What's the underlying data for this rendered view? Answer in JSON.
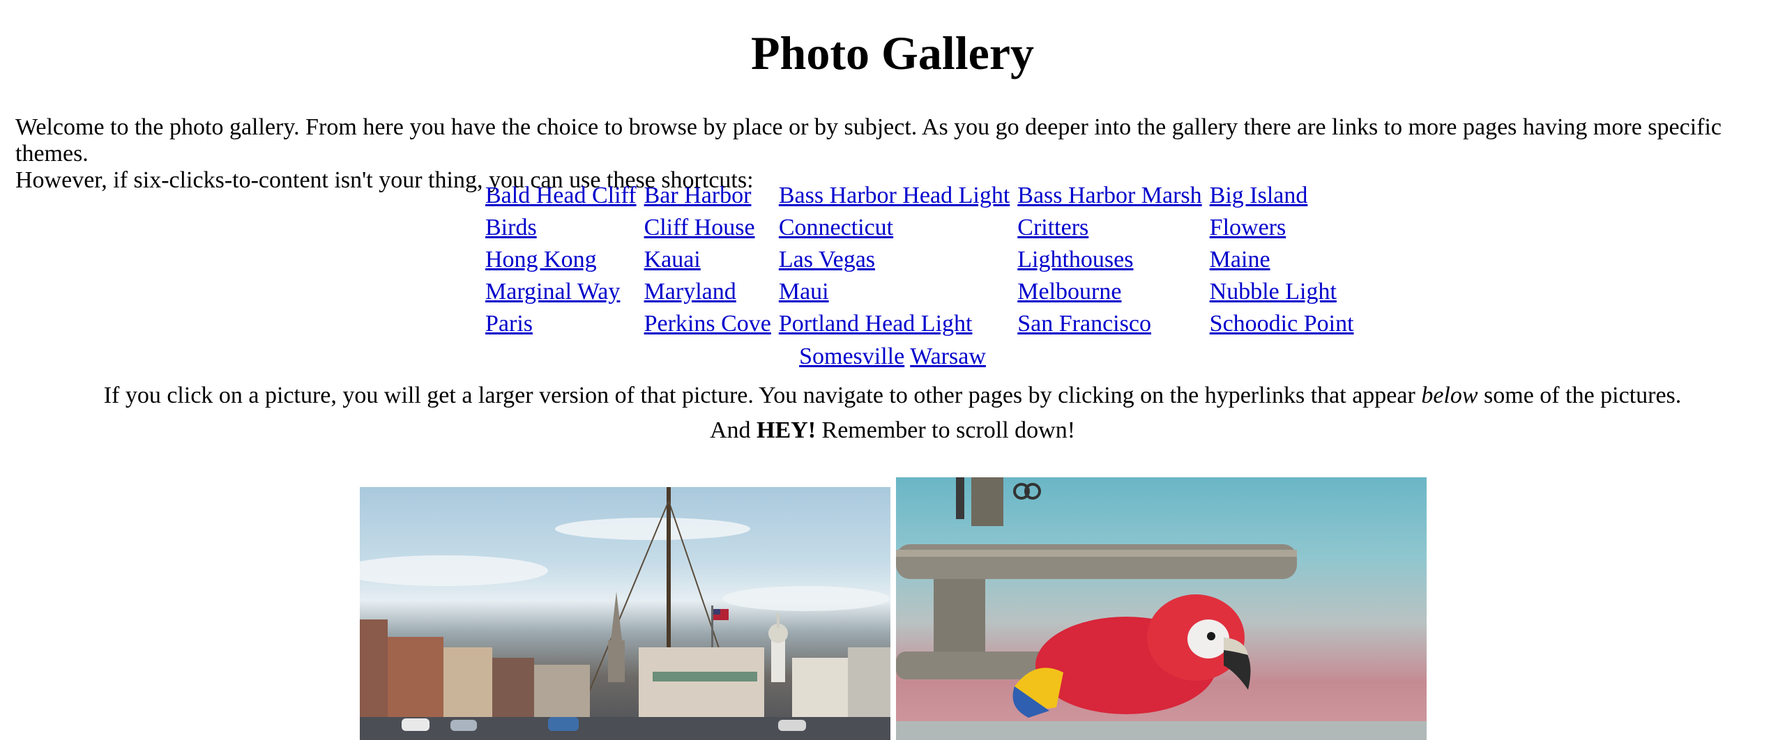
{
  "page": {
    "title": "Photo Gallery"
  },
  "intro": {
    "line1": "Welcome to the photo gallery.  From here you have the choice to browse by place or by subject.  As you go deeper into the gallery there are links to more pages having more specific themes.",
    "line2": "However, if six-clicks-to-content isn't your thing, you can use these shortcuts:"
  },
  "shortcuts": {
    "rows": [
      [
        "Bald Head Cliff",
        "Bar Harbor",
        "Bass Harbor Head Light",
        "Bass Harbor Marsh",
        "Big Island"
      ],
      [
        "Birds",
        "Cliff House",
        "Connecticut",
        "Critters",
        "Flowers"
      ],
      [
        "Hong Kong",
        "Kauai",
        "Las Vegas",
        "Lighthouses",
        "Maine"
      ],
      [
        "Marginal Way",
        "Maryland",
        "Maui",
        "Melbourne",
        "Nubble Light"
      ],
      [
        "Paris",
        "Perkins Cove",
        "Portland Head Light",
        "San Francisco",
        "Schoodic Point"
      ]
    ],
    "extra": [
      "Somesville",
      "Warsaw"
    ]
  },
  "instructions": {
    "part1": "If you click on a picture, you will get a larger version of that picture.  You navigate to other pages by clicking on the hyperlinks that appear ",
    "emphasis": "below",
    "part2": " some of the pictures.",
    "line2_prefix": "And ",
    "line2_bold": "HEY!",
    "line2_suffix": "  Remember to scroll down!"
  },
  "photos": [
    {
      "subject": "harbor-sailboat"
    },
    {
      "subject": "red-macaw-parrot"
    }
  ],
  "colors": {
    "link": "#0000cc",
    "text": "#000000",
    "background": "#ffffff"
  }
}
